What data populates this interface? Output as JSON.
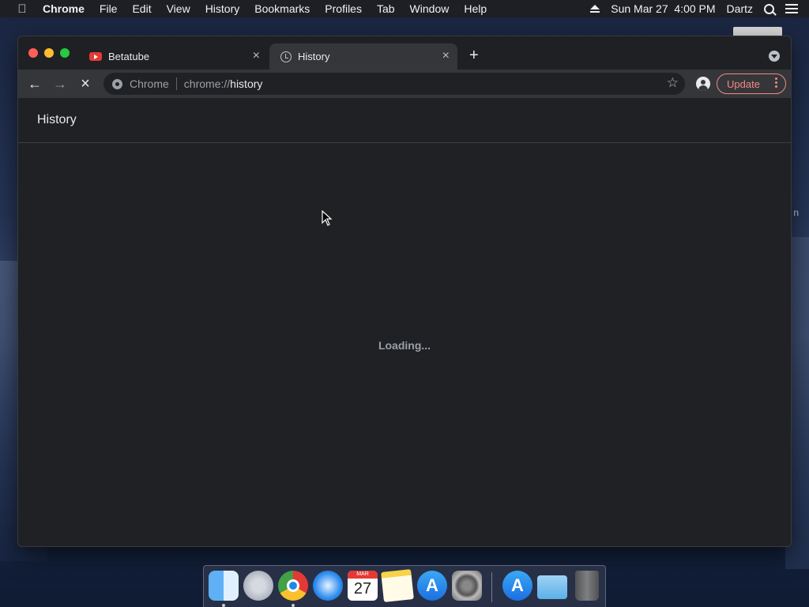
{
  "menubar": {
    "app": "Chrome",
    "items": [
      "File",
      "Edit",
      "View",
      "History",
      "Bookmarks",
      "Profiles",
      "Tab",
      "Window",
      "Help"
    ],
    "datetime": "Sun Mar 27  4:00 PM",
    "user": "Dartz"
  },
  "browser": {
    "tabs": [
      {
        "title": "Betatube",
        "icon": "youtube-icon",
        "active": false
      },
      {
        "title": "History",
        "icon": "history-icon",
        "active": true
      }
    ],
    "omnibox": {
      "chip": "Chrome",
      "url_scheme": "chrome://",
      "url_host": "history"
    },
    "update_label": "Update",
    "accent": "#f28b82"
  },
  "page": {
    "title": "History",
    "status": "Loading..."
  },
  "dock": {
    "calendar_month": "MAR",
    "calendar_day": "27",
    "items": [
      "finder-icon",
      "launchpad-icon",
      "chrome-icon",
      "safari-icon",
      "calendar-icon",
      "notes-icon",
      "app-store-icon",
      "system-preferences-icon",
      "app-store-icon",
      "downloads-folder-icon",
      "trash-icon"
    ]
  },
  "desktop": {
    "partial_text": "n"
  }
}
